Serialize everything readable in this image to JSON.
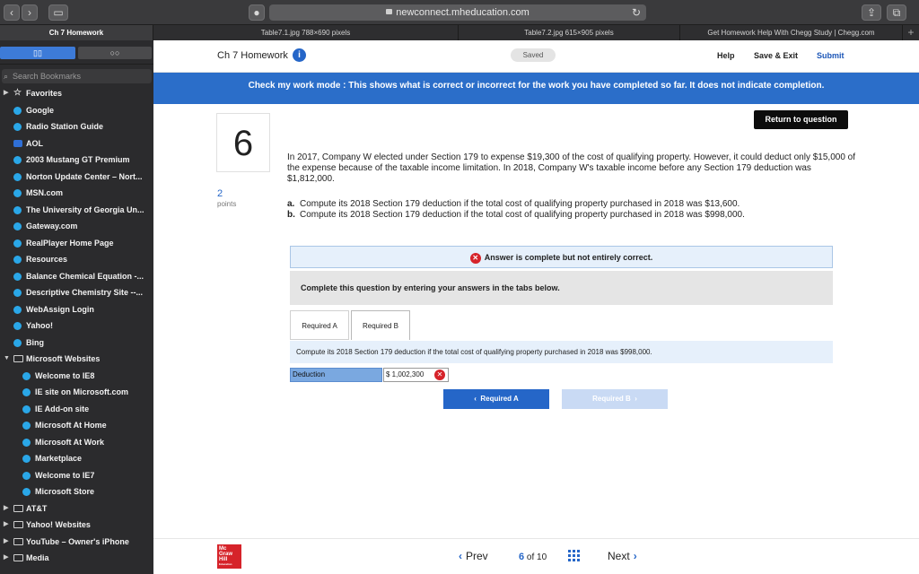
{
  "browser": {
    "url": "newconnect.mheducation.com",
    "tabs": [
      {
        "label": "Ch 7 Homework",
        "active": true
      },
      {
        "label": "Table7.1.jpg 788×690 pixels",
        "active": false
      },
      {
        "label": "Table7.2.jpg 615×905 pixels",
        "active": false
      },
      {
        "label": "Get Homework Help With Chegg Study | Chegg.com",
        "active": false
      }
    ]
  },
  "sidebar": {
    "search_placeholder": "Search Bookmarks",
    "items": [
      {
        "label": "Favorites",
        "level": 0,
        "icon": "star-icon"
      },
      {
        "label": "Google",
        "level": 1,
        "icon": "globe-icon"
      },
      {
        "label": "Radio Station Guide",
        "level": 1,
        "icon": "globe-icon"
      },
      {
        "label": "AOL",
        "level": 1,
        "icon": "aol-icon"
      },
      {
        "label": "2003 Mustang GT Premium",
        "level": 1,
        "icon": "globe-icon"
      },
      {
        "label": "Norton Update Center – Nort...",
        "level": 1,
        "icon": "globe-icon"
      },
      {
        "label": "MSN.com",
        "level": 1,
        "icon": "globe-icon"
      },
      {
        "label": "The University of Georgia Un...",
        "level": 1,
        "icon": "globe-icon"
      },
      {
        "label": "Gateway.com",
        "level": 1,
        "icon": "globe-icon"
      },
      {
        "label": "RealPlayer Home Page",
        "level": 1,
        "icon": "globe-icon"
      },
      {
        "label": "Resources",
        "level": 1,
        "icon": "globe-icon"
      },
      {
        "label": "Balance Chemical Equation -...",
        "level": 1,
        "icon": "globe-icon"
      },
      {
        "label": "Descriptive Chemistry Site --...",
        "level": 1,
        "icon": "globe-icon"
      },
      {
        "label": "WebAssign Login",
        "level": 1,
        "icon": "globe-icon"
      },
      {
        "label": "Yahoo!",
        "level": 1,
        "icon": "globe-icon"
      },
      {
        "label": "Bing",
        "level": 1,
        "icon": "globe-icon"
      },
      {
        "label": "Microsoft Websites",
        "level": 0,
        "icon": "folder-icon",
        "expanded": true
      },
      {
        "label": "Welcome to IE8",
        "level": 2,
        "icon": "globe-icon"
      },
      {
        "label": "IE site on Microsoft.com",
        "level": 2,
        "icon": "globe-icon"
      },
      {
        "label": "IE Add-on site",
        "level": 2,
        "icon": "globe-icon"
      },
      {
        "label": "Microsoft At Home",
        "level": 2,
        "icon": "globe-icon"
      },
      {
        "label": "Microsoft At Work",
        "level": 2,
        "icon": "globe-icon"
      },
      {
        "label": "Marketplace",
        "level": 2,
        "icon": "globe-icon"
      },
      {
        "label": "Welcome to IE7",
        "level": 2,
        "icon": "globe-icon"
      },
      {
        "label": "Microsoft Store",
        "level": 2,
        "icon": "globe-icon"
      },
      {
        "label": "AT&T",
        "level": 0,
        "icon": "folder-icon"
      },
      {
        "label": "Yahoo! Websites",
        "level": 0,
        "icon": "folder-icon"
      },
      {
        "label": "YouTube – Owner's iPhone",
        "level": 0,
        "icon": "folder-icon"
      },
      {
        "label": "Media",
        "level": 0,
        "icon": "folder-icon"
      }
    ]
  },
  "header": {
    "title": "Ch 7 Homework",
    "saved": "Saved",
    "help": "Help",
    "save_exit": "Save & Exit",
    "submit": "Submit"
  },
  "banner": "Check my work mode : This shows what is correct or incorrect for the work you have completed so far. It does not indicate completion.",
  "question": {
    "return_label": "Return to question",
    "number": "6",
    "points_value": "2",
    "points_label": "points",
    "text": "In 2017, Company W elected under Section 179 to expense $19,300 of the cost of qualifying property. However, it could deduct only $15,000 of the expense because of the taxable income limitation. In 2018, Company W's taxable income before any Section 179 deduction was $1,812,000.",
    "part_a_letter": "a.",
    "part_a": "Compute its 2018 Section 179 deduction if the total cost of qualifying property purchased in 2018 was $13,600.",
    "part_b_letter": "b.",
    "part_b": "Compute its 2018 Section 179 deduction if the total cost of qualifying property purchased in 2018 was $998,000."
  },
  "status": "Answer is complete but not entirely correct.",
  "instructions": "Complete this question by entering your answers in the tabs below.",
  "tabs": {
    "a": "Required A",
    "b": "Required B",
    "active": "b"
  },
  "required_b": {
    "prompt": "Compute its 2018 Section 179 deduction if the total cost of qualifying property purchased in 2018 was $998,000.",
    "field_label": "Deduction",
    "field_value": "$ 1,002,300"
  },
  "nav_buttons": {
    "prev": "Required A",
    "next": "Required B"
  },
  "footer": {
    "prev": "Prev",
    "current": "6",
    "of_total": "of 10",
    "next": "Next",
    "logo_text": "Mc Graw Hill",
    "logo_sub": "Education"
  },
  "colors": {
    "primary_blue": "#2566c8",
    "banner_blue": "#2b6ec9",
    "error_red": "#d6232a",
    "sidebar_bg": "#2b2b2d"
  }
}
